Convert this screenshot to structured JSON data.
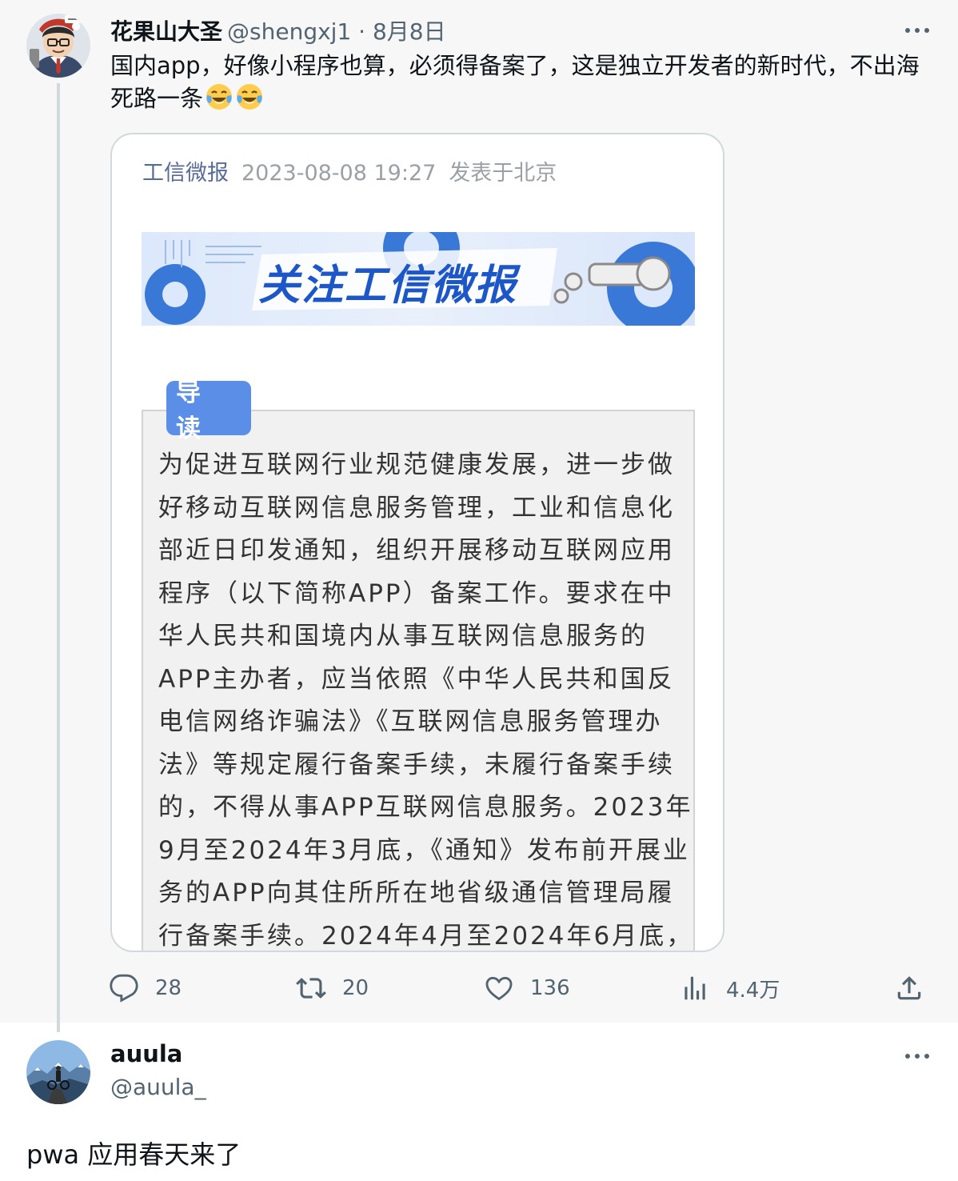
{
  "colors": {
    "top_background": "#f7f7f7",
    "thread_line": "#cfd9de",
    "text_primary": "#0f1419",
    "text_secondary": "#536471",
    "card_source": "#576b95",
    "guide_tag": "#5b8ee6"
  },
  "tweet": {
    "display_name": "花果山大圣",
    "handle_meta": "@shengxj1 · 8月8日",
    "text": "国内app，好像小程序也算，必须得备案了，这是独立开发者的新时代，不出海死路一条",
    "emojis": [
      "face-with-tears-of-joy-icon",
      "face-with-tears-of-joy-icon"
    ],
    "card": {
      "source": "工信微报",
      "datetime": "2023-08-08 19:27",
      "location": "发表于北京",
      "banner_text": "关注工信微报",
      "guide_tag": "导 读",
      "guide_lines": [
        "为促进互联网行业规范健康发展，进一步做",
        "好移动互联网信息服务管理，工业和信息化",
        "部近日印发通知，组织开展移动互联网应用",
        "程序（以下简称APP）备案工作。要求在中",
        "华人民共和国境内从事互联网信息服务的",
        "APP主办者，应当依照《中华人民共和国反",
        "电信网络诈骗法》《互联网信息服务管理办",
        "法》等规定履行备案手续，未履行备案手续",
        "的，不得从事APP互联网信息服务。2023年",
        "9月至2024年3月底，《通知》发布前开展业",
        "务的APP向其住所所在地省级通信管理局履",
        "行备案手续。2024年4月至2024年6月底，"
      ]
    },
    "actions": {
      "replies": "28",
      "retweets": "20",
      "likes": "136",
      "views": "4.4万"
    }
  },
  "reply": {
    "display_name": "auula",
    "handle": "@auula_",
    "text": "pwa 应用春天来了"
  }
}
